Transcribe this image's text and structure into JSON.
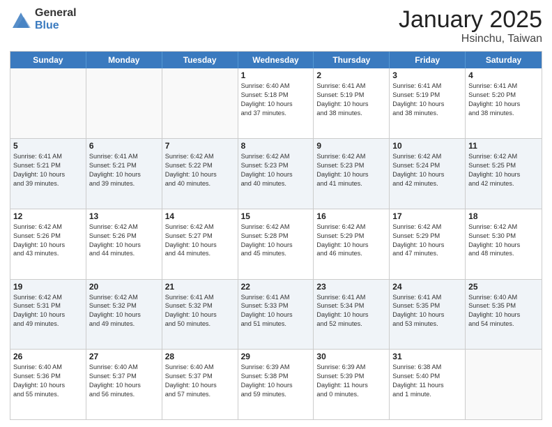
{
  "logo": {
    "general": "General",
    "blue": "Blue"
  },
  "header": {
    "title": "January 2025",
    "subtitle": "Hsinchu, Taiwan"
  },
  "days_of_week": [
    "Sunday",
    "Monday",
    "Tuesday",
    "Wednesday",
    "Thursday",
    "Friday",
    "Saturday"
  ],
  "weeks": [
    [
      {
        "day": "",
        "info": ""
      },
      {
        "day": "",
        "info": ""
      },
      {
        "day": "",
        "info": ""
      },
      {
        "day": "1",
        "info": "Sunrise: 6:40 AM\nSunset: 5:18 PM\nDaylight: 10 hours\nand 37 minutes."
      },
      {
        "day": "2",
        "info": "Sunrise: 6:41 AM\nSunset: 5:19 PM\nDaylight: 10 hours\nand 38 minutes."
      },
      {
        "day": "3",
        "info": "Sunrise: 6:41 AM\nSunset: 5:19 PM\nDaylight: 10 hours\nand 38 minutes."
      },
      {
        "day": "4",
        "info": "Sunrise: 6:41 AM\nSunset: 5:20 PM\nDaylight: 10 hours\nand 38 minutes."
      }
    ],
    [
      {
        "day": "5",
        "info": "Sunrise: 6:41 AM\nSunset: 5:21 PM\nDaylight: 10 hours\nand 39 minutes."
      },
      {
        "day": "6",
        "info": "Sunrise: 6:41 AM\nSunset: 5:21 PM\nDaylight: 10 hours\nand 39 minutes."
      },
      {
        "day": "7",
        "info": "Sunrise: 6:42 AM\nSunset: 5:22 PM\nDaylight: 10 hours\nand 40 minutes."
      },
      {
        "day": "8",
        "info": "Sunrise: 6:42 AM\nSunset: 5:23 PM\nDaylight: 10 hours\nand 40 minutes."
      },
      {
        "day": "9",
        "info": "Sunrise: 6:42 AM\nSunset: 5:23 PM\nDaylight: 10 hours\nand 41 minutes."
      },
      {
        "day": "10",
        "info": "Sunrise: 6:42 AM\nSunset: 5:24 PM\nDaylight: 10 hours\nand 42 minutes."
      },
      {
        "day": "11",
        "info": "Sunrise: 6:42 AM\nSunset: 5:25 PM\nDaylight: 10 hours\nand 42 minutes."
      }
    ],
    [
      {
        "day": "12",
        "info": "Sunrise: 6:42 AM\nSunset: 5:26 PM\nDaylight: 10 hours\nand 43 minutes."
      },
      {
        "day": "13",
        "info": "Sunrise: 6:42 AM\nSunset: 5:26 PM\nDaylight: 10 hours\nand 44 minutes."
      },
      {
        "day": "14",
        "info": "Sunrise: 6:42 AM\nSunset: 5:27 PM\nDaylight: 10 hours\nand 44 minutes."
      },
      {
        "day": "15",
        "info": "Sunrise: 6:42 AM\nSunset: 5:28 PM\nDaylight: 10 hours\nand 45 minutes."
      },
      {
        "day": "16",
        "info": "Sunrise: 6:42 AM\nSunset: 5:29 PM\nDaylight: 10 hours\nand 46 minutes."
      },
      {
        "day": "17",
        "info": "Sunrise: 6:42 AM\nSunset: 5:29 PM\nDaylight: 10 hours\nand 47 minutes."
      },
      {
        "day": "18",
        "info": "Sunrise: 6:42 AM\nSunset: 5:30 PM\nDaylight: 10 hours\nand 48 minutes."
      }
    ],
    [
      {
        "day": "19",
        "info": "Sunrise: 6:42 AM\nSunset: 5:31 PM\nDaylight: 10 hours\nand 49 minutes."
      },
      {
        "day": "20",
        "info": "Sunrise: 6:42 AM\nSunset: 5:32 PM\nDaylight: 10 hours\nand 49 minutes."
      },
      {
        "day": "21",
        "info": "Sunrise: 6:41 AM\nSunset: 5:32 PM\nDaylight: 10 hours\nand 50 minutes."
      },
      {
        "day": "22",
        "info": "Sunrise: 6:41 AM\nSunset: 5:33 PM\nDaylight: 10 hours\nand 51 minutes."
      },
      {
        "day": "23",
        "info": "Sunrise: 6:41 AM\nSunset: 5:34 PM\nDaylight: 10 hours\nand 52 minutes."
      },
      {
        "day": "24",
        "info": "Sunrise: 6:41 AM\nSunset: 5:35 PM\nDaylight: 10 hours\nand 53 minutes."
      },
      {
        "day": "25",
        "info": "Sunrise: 6:40 AM\nSunset: 5:35 PM\nDaylight: 10 hours\nand 54 minutes."
      }
    ],
    [
      {
        "day": "26",
        "info": "Sunrise: 6:40 AM\nSunset: 5:36 PM\nDaylight: 10 hours\nand 55 minutes."
      },
      {
        "day": "27",
        "info": "Sunrise: 6:40 AM\nSunset: 5:37 PM\nDaylight: 10 hours\nand 56 minutes."
      },
      {
        "day": "28",
        "info": "Sunrise: 6:40 AM\nSunset: 5:37 PM\nDaylight: 10 hours\nand 57 minutes."
      },
      {
        "day": "29",
        "info": "Sunrise: 6:39 AM\nSunset: 5:38 PM\nDaylight: 10 hours\nand 59 minutes."
      },
      {
        "day": "30",
        "info": "Sunrise: 6:39 AM\nSunset: 5:39 PM\nDaylight: 11 hours\nand 0 minutes."
      },
      {
        "day": "31",
        "info": "Sunrise: 6:38 AM\nSunset: 5:40 PM\nDaylight: 11 hours\nand 1 minute."
      },
      {
        "day": "",
        "info": ""
      }
    ]
  ],
  "alt_rows": [
    1,
    3
  ]
}
